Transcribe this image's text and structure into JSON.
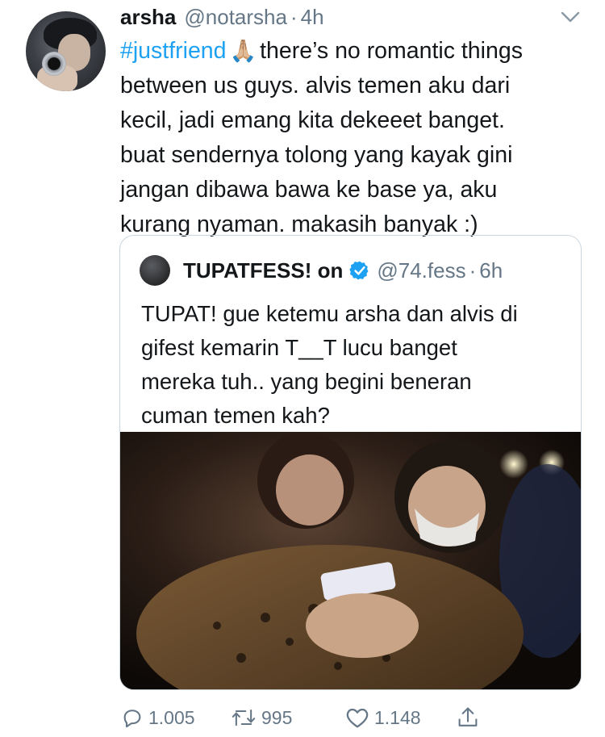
{
  "tweet": {
    "author_name": "arsha",
    "author_handle": "@notarsha",
    "separator": "·",
    "time": "4h",
    "hashtag": "#justfriend",
    "emoji": "🙏🏼",
    "lines": [
      "there’s no romantic things",
      "between us guys. alvis temen aku dari",
      "kecil, jadi emang kita dekeeet banget.",
      "buat sendernya tolong yang kayak gini",
      "jangan dibawa bawa ke base ya, aku",
      "kurang nyaman. makasih banyak :)"
    ]
  },
  "quoted": {
    "author_name": "TUPATFESS! on",
    "author_handle": "@74.fess",
    "separator": "·",
    "time": "6h",
    "lines": [
      "TUPAT! gue ketemu arsha dan alvis di",
      "gifest kemarin T__T lucu banget",
      "mereka tuh.. yang begini beneran",
      "cuman temen kah?"
    ]
  },
  "actions": {
    "replies": "1.005",
    "retweets": "995",
    "likes": "1.148"
  },
  "colors": {
    "link": "#1da1f2",
    "secondary": "#657786",
    "border": "#ccd6dd"
  },
  "icons": [
    "chevron-down-icon",
    "verified-badge-icon",
    "reply-icon",
    "retweet-icon",
    "like-icon",
    "share-icon"
  ]
}
